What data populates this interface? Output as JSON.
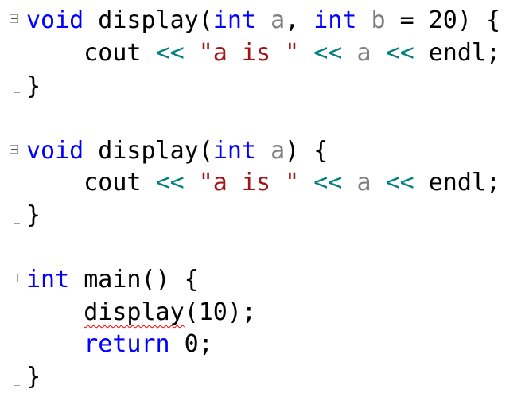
{
  "editor": {
    "language": "C++",
    "colors": {
      "keyword": "#0000ff",
      "parameter": "#808080",
      "string": "#a31515",
      "operator": "#008080",
      "text": "#000000",
      "error_squiggle": "#ff0000"
    },
    "blocks": [
      {
        "header": {
          "kw1": "void",
          "name": " display(",
          "kw2": "int",
          "p1": "a",
          "sep": ", ",
          "kw3": "int",
          "p2": "b",
          "rest": " = 20) {"
        },
        "body": {
          "indent": "    ",
          "cout": "cout",
          "op1": "<<",
          "str": "\"a is \"",
          "op2": "<<",
          "var": "a",
          "op3": "<<",
          "endl": "endl;"
        },
        "close": "}"
      },
      {
        "header": {
          "kw1": "void",
          "name": " display(",
          "kw2": "int",
          "p1": "a",
          "rest": ") {"
        },
        "body": {
          "indent": "    ",
          "cout": "cout",
          "op1": "<<",
          "str": "\"a is \"",
          "op2": "<<",
          "var": "a",
          "op3": "<<",
          "endl": "endl;"
        },
        "close": "}"
      },
      {
        "header": {
          "kw1": "int",
          "rest": " main() {"
        },
        "call": {
          "indent": "    ",
          "fn": "display",
          "args": "(10);"
        },
        "ret": {
          "indent": "    ",
          "kw": "return",
          "value": " 0;"
        },
        "close": "}"
      }
    ]
  }
}
